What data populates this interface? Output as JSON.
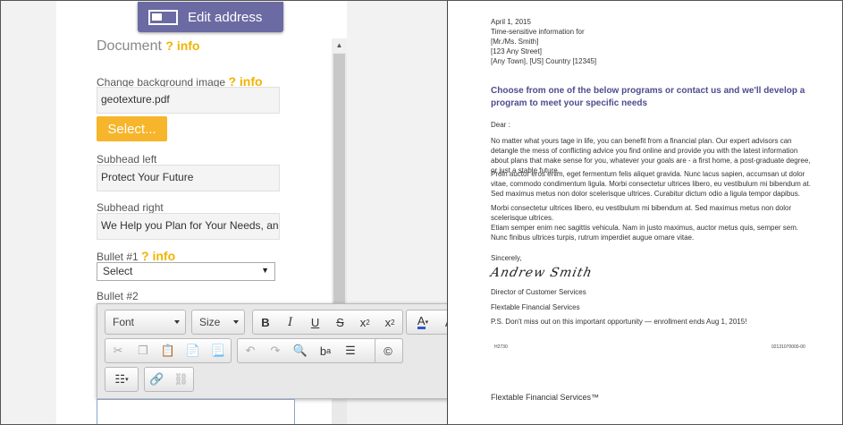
{
  "header": {
    "edit_address_label": "Edit address"
  },
  "document": {
    "title": "Document",
    "info": "? info",
    "bg_label": "Change background image",
    "bg_file": "geotexture.pdf",
    "select_label": "Select...",
    "subhead_left_label": "Subhead left",
    "subhead_left_value": "Protect Your Future",
    "subhead_right_label": "Subhead right",
    "subhead_right_value": "We Help you Plan for Your Needs, and",
    "bullet1_label": "Bullet #1",
    "bullet1_select": "Select",
    "bullet2_label": "Bullet #2"
  },
  "toolbar": {
    "font_label": "Font",
    "size_label": "Size"
  },
  "letter": {
    "date": "April 1, 2015",
    "line1": "Time-sensitive information for",
    "line2": "[Mr./Ms. Smith]",
    "line3": "[123 Any Street]",
    "line4": "[Any Town], [US] Country [12345]",
    "headline": "Choose from one of the below programs or contact us and we'll develop a program to meet your specific needs",
    "dear": "Dear :",
    "p1": "No matter what yours tage in life, you can benefit from a financial plan. Our expert advisors can detangle the mess of conflicting advice you find online and provide you with the latest information about plans that make sense for you, whatever your goals are - a first home, a post-graduate degree, or just a stable future.",
    "p2": "Proin auctor eros enim, eget fermentum felis aliquet gravida. Nunc lacus sapien, accumsan ut dolor vitae, commodo condimentum ligula. Morbi consectetur ultrices libero, eu vestibulum mi bibendum at. Sed maximus metus non dolor scelerisque ultrices. Curabitur dictum odio a ligula tempor dapibus.",
    "p3": "Morbi consectetur ultrices libero, eu vestibulum mi bibendum at. Sed maximus metus non dolor scelerisque ultrices.",
    "p4": "Etiam semper enim nec sagittis vehicula. Nam in justo maximus, auctor metus quis, semper sem. Nunc finibus ultrices turpis, rutrum imperdiet augue ornare vitae.",
    "sincerely": "Sincerely,",
    "signature": "Andrew Smith",
    "sig_title": "Director of Customer Services",
    "sig_company": "Flextable Financial Services",
    "ps": "P.S. Don't miss out on this important opportunity — enrollment ends Aug 1, 2015!",
    "code_left": "H2730",
    "code_right": "02131070000-00",
    "footer_company": "Flextable Financial Services™"
  }
}
